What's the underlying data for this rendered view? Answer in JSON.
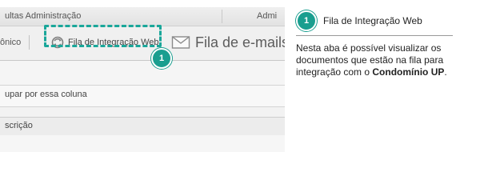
{
  "screenshot": {
    "menubar": {
      "left_text": "ultas Administração",
      "right_text": "Admi"
    },
    "tabs": {
      "previous_tab_label": "ônico",
      "active_tab_label": "Fila de Integração Web",
      "email_tab_label": "Fila de e-mails"
    },
    "group_row_text": "upar por essa coluna",
    "column_header_text": "scrição"
  },
  "callout": {
    "number": "1",
    "title": "Fila de Integração Web",
    "description_prefix": "Nesta aba é possível visualizar os documentos que estão na fila para integração com o ",
    "description_bold": "Condomínio UP",
    "description_suffix": "."
  },
  "colors": {
    "accent": "#1aa79a",
    "marker": "#1a9e8f"
  },
  "icons": {
    "active_tab_icon": "refresh-sync-icon",
    "email_tab_icon": "envelope-icon"
  }
}
